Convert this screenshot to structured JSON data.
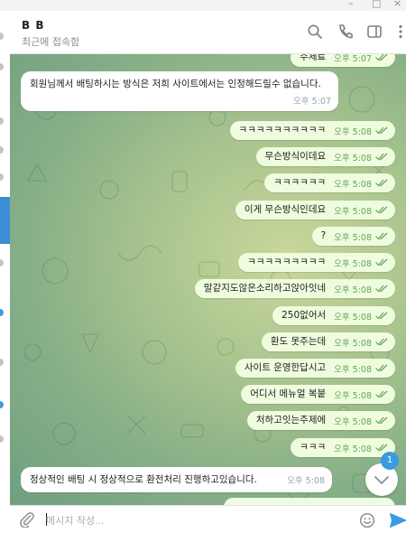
{
  "header": {
    "name": "B B",
    "status": "최근에 접속함"
  },
  "composer": {
    "placeholder": "메시지 작성..."
  },
  "scroll": {
    "unread_count": "1"
  },
  "colors": {
    "outgoing_bubble": "#effdde",
    "incoming_bubble": "#ffffff",
    "accent": "#3a9be0",
    "read_check": "#62a35b"
  },
  "messages": [
    {
      "dir": "out",
      "text": "주제료",
      "time": "오후 5:07"
    },
    {
      "dir": "in",
      "text": "회원님께서 배팅하시는 방식은 저희 사이트에서는 인정해드릴수 없습니다.",
      "time": "오후 5:07"
    },
    {
      "dir": "out",
      "text": "ㅋㅋㅋㅋㅋㅋㅋㅋㅋㅋ",
      "time": "오후 5:08"
    },
    {
      "dir": "out",
      "text": "무슨방식이데요",
      "time": "오후 5:08"
    },
    {
      "dir": "out",
      "text": "ㅋㅋㅋㅋㅋㅋ",
      "time": "오후 5:08"
    },
    {
      "dir": "out",
      "text": "이게 무슨방식인데요",
      "time": "오후 5:08"
    },
    {
      "dir": "out",
      "text": "?",
      "time": "오후 5:08"
    },
    {
      "dir": "out",
      "text": "ㅋㅋㅋㅋㅋㅋㅋㅋㅋ",
      "time": "오후 5:08"
    },
    {
      "dir": "out",
      "text": "말같지도않은소리하고앉아잇네",
      "time": "오후 5:08"
    },
    {
      "dir": "out",
      "text": "250없어서",
      "time": "오후 5:08"
    },
    {
      "dir": "out",
      "text": "환도 못주는데",
      "time": "오후 5:08"
    },
    {
      "dir": "out",
      "text": "사이트 운영한답시고",
      "time": "오후 5:08"
    },
    {
      "dir": "out",
      "text": "어디서 메뉴얼 복붙",
      "time": "오후 5:08"
    },
    {
      "dir": "out",
      "text": "처하고잇는주제에",
      "time": "오후 5:08"
    },
    {
      "dir": "out",
      "text": "ㅋㅋㅋ",
      "time": "오후 5:08"
    },
    {
      "dir": "in",
      "text": "정상적인 배팅 시 정상적으로 환전처리 진행하고있습니다.",
      "time": "오후 5:08"
    }
  ]
}
